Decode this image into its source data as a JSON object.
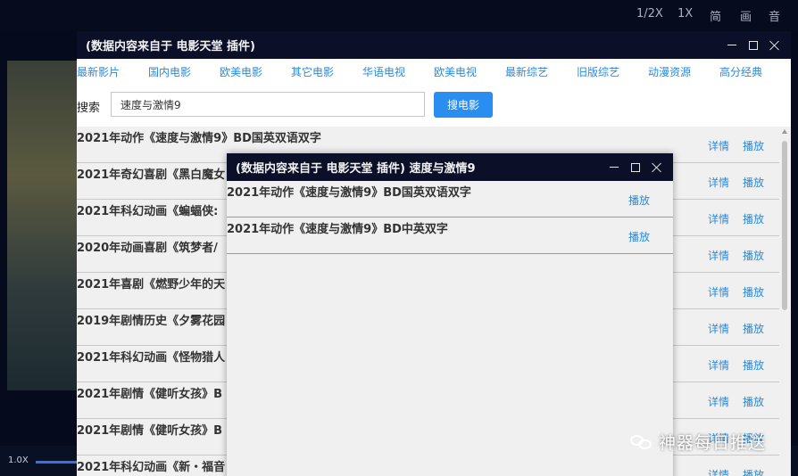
{
  "player": {
    "controls": [
      "1/2X",
      "1X",
      "简",
      "画",
      "音"
    ],
    "speed": "1.0X"
  },
  "main_window": {
    "title": "(数据内容来自于 电影天堂 插件)",
    "categories": [
      "最新影片",
      "国内电影",
      "欧美电影",
      "其它电影",
      "华语电视",
      "欧美电视",
      "最新综艺",
      "旧版综艺",
      "动漫资源",
      "高分经典"
    ],
    "search_label": "搜索",
    "search_value": "速度与激情9",
    "search_button": "搜电影",
    "detail_label": "详情",
    "play_label": "播放",
    "rows": [
      "2021年动作《速度与激情9》BD国英双语双字",
      "2021年奇幻喜剧《黑白魔女",
      "2021年科幻动画《蝙蝠侠:",
      "2020年动画喜剧《筑梦者/",
      "2021年喜剧《燃野少年的天",
      "2019年剧情历史《夕雾花园",
      "2021年科幻动画《怪物猎人",
      "2021年剧情《健听女孩》B",
      "2021年剧情《健听女孩》B",
      "2021年科幻动画《新・福音"
    ]
  },
  "popup_window": {
    "title": "(数据内容来自于 电影天堂 插件) 速度与激情9",
    "play_label": "播放",
    "rows": [
      "2021年动作《速度与激情9》BD国英双语双字",
      "2021年动作《速度与激情9》BD中英双字"
    ]
  },
  "watermark": "神器每日推送"
}
